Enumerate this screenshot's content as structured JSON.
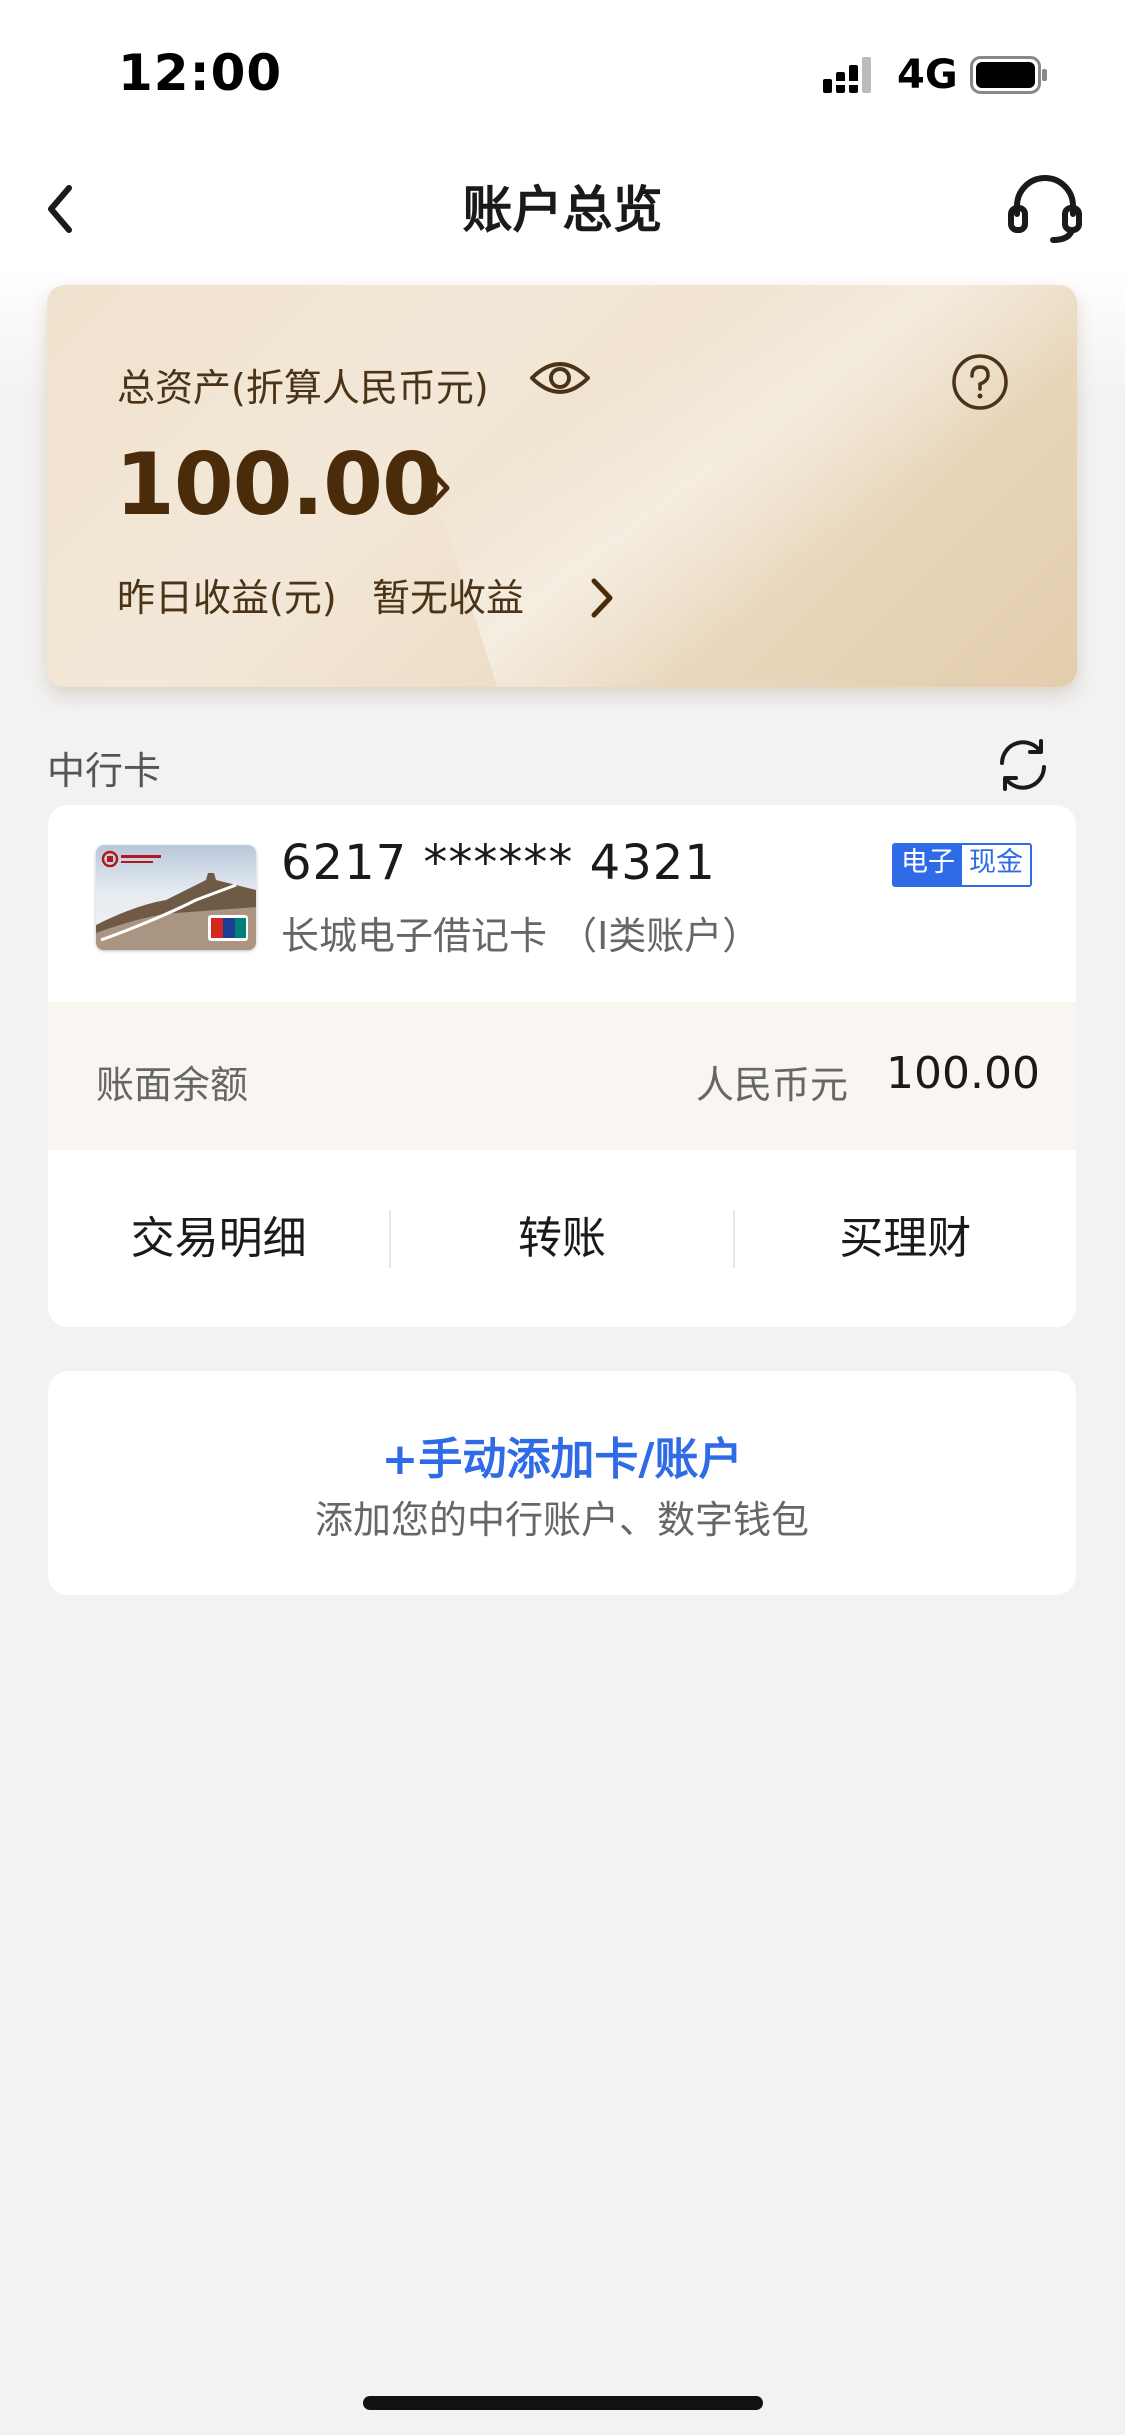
{
  "status_bar": {
    "time": "12:00",
    "network": "4G"
  },
  "nav": {
    "title": "账户总览"
  },
  "assets": {
    "label": "总资产(折算人民币元)",
    "amount": "100.00",
    "yesterday_label": "昨日收益(元)",
    "yesterday_value": "暂无收益"
  },
  "section": {
    "title": "中行卡"
  },
  "card": {
    "number": "6217 ****** 4321",
    "name": "长城电子借记卡 （I类账户）",
    "tags": [
      "电子",
      "现金"
    ],
    "balance_label": "账面余额",
    "currency": "人民币元",
    "balance": "100.00",
    "actions": [
      "交易明细",
      "转账",
      "买理财"
    ]
  },
  "add_account": {
    "title": "+手动添加卡/账户",
    "subtitle": "添加您的中行账户、数字钱包"
  },
  "colors": {
    "accent_blue": "#2f6be6",
    "gold_text": "#4a2c0b",
    "background": "#f2f2f2"
  },
  "icons": [
    "back-arrow",
    "headset",
    "eye",
    "help-circle",
    "chevron-right",
    "refresh",
    "signal",
    "battery"
  ]
}
